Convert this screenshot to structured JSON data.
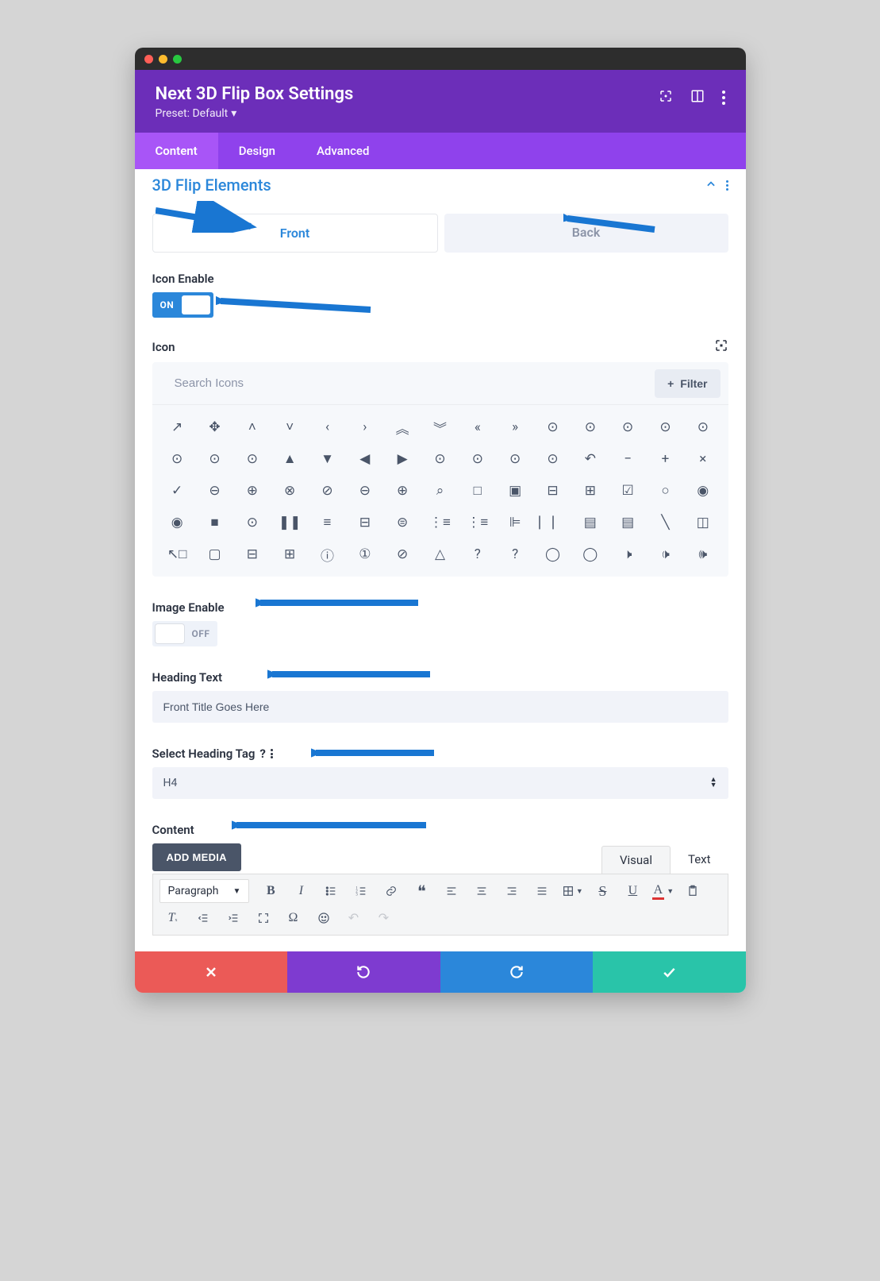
{
  "header": {
    "title": "Next 3D Flip Box Settings",
    "preset_label": "Preset: Default"
  },
  "tabs": {
    "content": "Content",
    "design": "Design",
    "advanced": "Advanced"
  },
  "section": {
    "title": "3D Flip Elements"
  },
  "subtabs": {
    "front": "Front",
    "back": "Back"
  },
  "fields": {
    "icon_enable_label": "Icon Enable",
    "icon_enable_value": "ON",
    "icon_label": "Icon",
    "search_placeholder": "Search Icons",
    "filter_label": "Filter",
    "image_enable_label": "Image Enable",
    "image_enable_value": "OFF",
    "heading_text_label": "Heading Text",
    "heading_text_value": "Front Title Goes Here",
    "heading_tag_label": "Select Heading Tag",
    "heading_tag_value": "H4",
    "content_label": "Content",
    "add_media_label": "ADD MEDIA",
    "editor_visual": "Visual",
    "editor_text": "Text",
    "paragraph_label": "Paragraph"
  },
  "icon_glyphs": [
    "↗",
    "✥",
    "˄",
    "˅",
    "‹",
    "›",
    "︽",
    "︾",
    "«",
    "»",
    "⊙",
    "⊙",
    "⊙",
    "⊙",
    "⊙",
    "⊙",
    "⊙",
    "⊙",
    "▲",
    "▼",
    "◀",
    "▶",
    "⊙",
    "⊙",
    "⊙",
    "⊙",
    "↶",
    "−",
    "+",
    "×",
    "✓",
    "⊖",
    "⊕",
    "⊗",
    "⊘",
    "⊖",
    "⊕",
    "⌕",
    "□",
    "▣",
    "⊟",
    "⊞",
    "☑",
    "○",
    "◉",
    "◉",
    "■",
    "⊙",
    "❚❚",
    "≡",
    "⊟",
    "⊜",
    "⋮≡",
    "⋮≡",
    "⊫",
    "⎸⎸",
    "▤",
    "▤",
    "╲",
    "◫",
    "↖□",
    "▢",
    "⊟",
    "⊞",
    "ⓘ",
    "①",
    "⊘",
    "△",
    "?",
    "?",
    "◯",
    "◯",
    "🕨",
    "🕩",
    "🕪"
  ]
}
